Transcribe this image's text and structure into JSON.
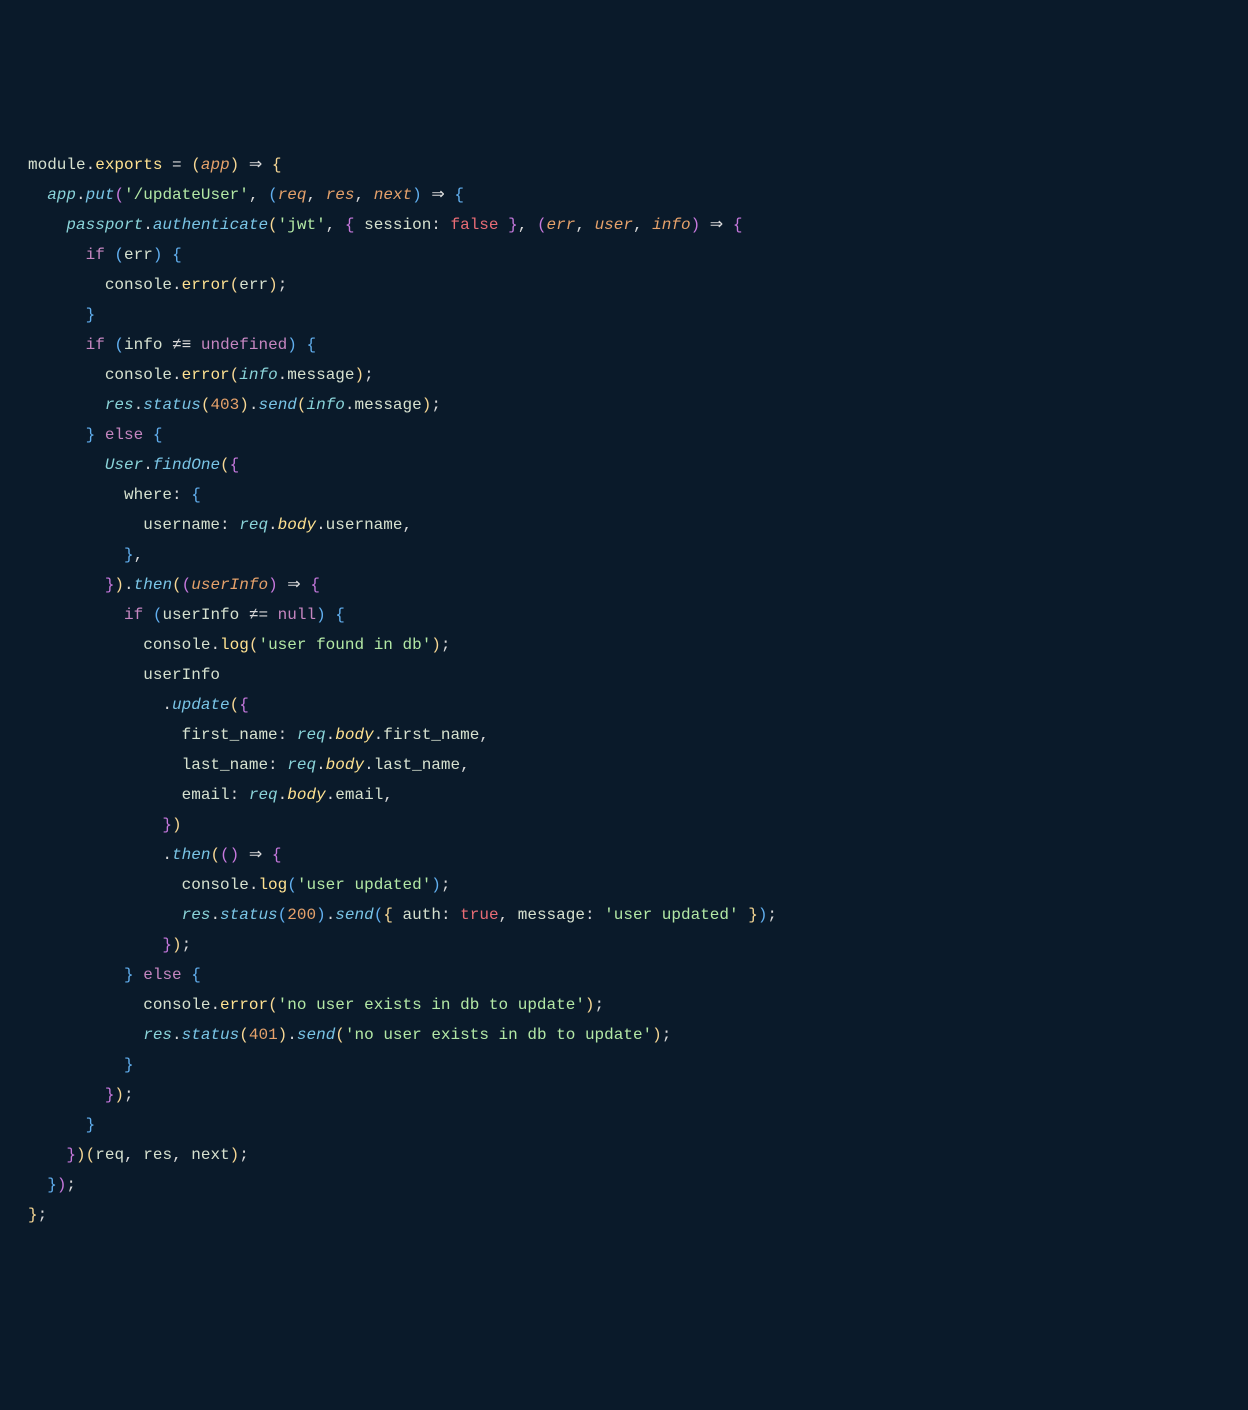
{
  "lines": [
    [
      [
        "t-obj",
        "module"
      ],
      [
        "t-punc",
        "."
      ],
      [
        "t-prop",
        "exports"
      ],
      [
        "t-punc",
        " = "
      ],
      [
        "t-paren",
        "("
      ],
      [
        "t-param",
        "app"
      ],
      [
        "t-paren",
        ")"
      ],
      [
        "t-id",
        " "
      ],
      [
        "t-arrow",
        "⇒"
      ],
      [
        "t-id",
        " "
      ],
      [
        "t-paren",
        "{"
      ]
    ],
    [
      [
        "t-id",
        "  "
      ],
      [
        "t-varital",
        "app"
      ],
      [
        "t-punc",
        "."
      ],
      [
        "t-methital",
        "put"
      ],
      [
        "t-paren2",
        "("
      ],
      [
        "t-str",
        "'/updateUser'"
      ],
      [
        "t-punc",
        ", "
      ],
      [
        "t-paren3",
        "("
      ],
      [
        "t-param",
        "req"
      ],
      [
        "t-punc",
        ", "
      ],
      [
        "t-param",
        "res"
      ],
      [
        "t-punc",
        ", "
      ],
      [
        "t-param",
        "next"
      ],
      [
        "t-paren3",
        ")"
      ],
      [
        "t-id",
        " "
      ],
      [
        "t-arrow",
        "⇒"
      ],
      [
        "t-id",
        " "
      ],
      [
        "t-paren3",
        "{"
      ]
    ],
    [
      [
        "t-id",
        "    "
      ],
      [
        "t-varital",
        "passport"
      ],
      [
        "t-punc",
        "."
      ],
      [
        "t-methital",
        "authenticate"
      ],
      [
        "t-paren",
        "("
      ],
      [
        "t-str",
        "'jwt'"
      ],
      [
        "t-punc",
        ", "
      ],
      [
        "t-paren2",
        "{"
      ],
      [
        "t-id",
        " session"
      ],
      [
        "t-punc",
        ": "
      ],
      [
        "t-bool",
        "false"
      ],
      [
        "t-id",
        " "
      ],
      [
        "t-paren2",
        "}"
      ],
      [
        "t-punc",
        ", "
      ],
      [
        "t-paren2",
        "("
      ],
      [
        "t-param",
        "err"
      ],
      [
        "t-punc",
        ", "
      ],
      [
        "t-param",
        "user"
      ],
      [
        "t-punc",
        ", "
      ],
      [
        "t-param",
        "info"
      ],
      [
        "t-paren2",
        ")"
      ],
      [
        "t-id",
        " "
      ],
      [
        "t-arrow",
        "⇒"
      ],
      [
        "t-id",
        " "
      ],
      [
        "t-paren2",
        "{"
      ]
    ],
    [
      [
        "t-id",
        "      "
      ],
      [
        "t-keyword",
        "if"
      ],
      [
        "t-id",
        " "
      ],
      [
        "t-paren3",
        "("
      ],
      [
        "t-id",
        "err"
      ],
      [
        "t-paren3",
        ")"
      ],
      [
        "t-id",
        " "
      ],
      [
        "t-paren3",
        "{"
      ]
    ],
    [
      [
        "t-id",
        "        "
      ],
      [
        "t-obj",
        "console"
      ],
      [
        "t-punc",
        "."
      ],
      [
        "t-prop",
        "error"
      ],
      [
        "t-paren",
        "("
      ],
      [
        "t-id",
        "err"
      ],
      [
        "t-paren",
        ")"
      ],
      [
        "t-punc",
        ";"
      ]
    ],
    [
      [
        "t-id",
        "      "
      ],
      [
        "t-paren3",
        "}"
      ]
    ],
    [
      [
        "t-id",
        "      "
      ],
      [
        "t-keyword",
        "if"
      ],
      [
        "t-id",
        " "
      ],
      [
        "t-paren3",
        "("
      ],
      [
        "t-id",
        "info "
      ],
      [
        "t-punc",
        "≠≡"
      ],
      [
        "t-id",
        " "
      ],
      [
        "t-lit",
        "undefined"
      ],
      [
        "t-paren3",
        ")"
      ],
      [
        "t-id",
        " "
      ],
      [
        "t-paren3",
        "{"
      ]
    ],
    [
      [
        "t-id",
        "        "
      ],
      [
        "t-obj",
        "console"
      ],
      [
        "t-punc",
        "."
      ],
      [
        "t-prop",
        "error"
      ],
      [
        "t-paren",
        "("
      ],
      [
        "t-varital",
        "info"
      ],
      [
        "t-punc",
        "."
      ],
      [
        "t-id",
        "message"
      ],
      [
        "t-paren",
        ")"
      ],
      [
        "t-punc",
        ";"
      ]
    ],
    [
      [
        "t-id",
        "        "
      ],
      [
        "t-varital",
        "res"
      ],
      [
        "t-punc",
        "."
      ],
      [
        "t-methital",
        "status"
      ],
      [
        "t-paren",
        "("
      ],
      [
        "t-num",
        "403"
      ],
      [
        "t-paren",
        ")"
      ],
      [
        "t-punc",
        "."
      ],
      [
        "t-methital",
        "send"
      ],
      [
        "t-paren",
        "("
      ],
      [
        "t-varital",
        "info"
      ],
      [
        "t-punc",
        "."
      ],
      [
        "t-id",
        "message"
      ],
      [
        "t-paren",
        ")"
      ],
      [
        "t-punc",
        ";"
      ]
    ],
    [
      [
        "t-id",
        "      "
      ],
      [
        "t-paren3",
        "}"
      ],
      [
        "t-id",
        " "
      ],
      [
        "t-keyword",
        "else"
      ],
      [
        "t-id",
        " "
      ],
      [
        "t-paren3",
        "{"
      ]
    ],
    [
      [
        "t-id",
        "        "
      ],
      [
        "t-varital",
        "User"
      ],
      [
        "t-punc",
        "."
      ],
      [
        "t-methital",
        "findOne"
      ],
      [
        "t-paren",
        "("
      ],
      [
        "t-paren2",
        "{"
      ]
    ],
    [
      [
        "t-id",
        "          where"
      ],
      [
        "t-punc",
        ": "
      ],
      [
        "t-paren3",
        "{"
      ]
    ],
    [
      [
        "t-id",
        "            username"
      ],
      [
        "t-punc",
        ": "
      ],
      [
        "t-varital",
        "req"
      ],
      [
        "t-punc",
        "."
      ],
      [
        "t-propital",
        "body"
      ],
      [
        "t-punc",
        "."
      ],
      [
        "t-id",
        "username"
      ],
      [
        "t-punc",
        ","
      ]
    ],
    [
      [
        "t-id",
        "          "
      ],
      [
        "t-paren3",
        "}"
      ],
      [
        "t-punc",
        ","
      ]
    ],
    [
      [
        "t-id",
        "        "
      ],
      [
        "t-paren2",
        "}"
      ],
      [
        "t-paren",
        ")"
      ],
      [
        "t-punc",
        "."
      ],
      [
        "t-methital",
        "then"
      ],
      [
        "t-paren",
        "("
      ],
      [
        "t-paren2",
        "("
      ],
      [
        "t-param",
        "userInfo"
      ],
      [
        "t-paren2",
        ")"
      ],
      [
        "t-id",
        " "
      ],
      [
        "t-arrow",
        "⇒"
      ],
      [
        "t-id",
        " "
      ],
      [
        "t-paren2",
        "{"
      ]
    ],
    [
      [
        "t-id",
        "          "
      ],
      [
        "t-keyword",
        "if"
      ],
      [
        "t-id",
        " "
      ],
      [
        "t-paren3",
        "("
      ],
      [
        "t-id",
        "userInfo "
      ],
      [
        "t-punc",
        "≠="
      ],
      [
        "t-id",
        " "
      ],
      [
        "t-lit",
        "null"
      ],
      [
        "t-paren3",
        ")"
      ],
      [
        "t-id",
        " "
      ],
      [
        "t-paren3",
        "{"
      ]
    ],
    [
      [
        "t-id",
        "            "
      ],
      [
        "t-obj",
        "console"
      ],
      [
        "t-punc",
        "."
      ],
      [
        "t-prop",
        "log"
      ],
      [
        "t-paren",
        "("
      ],
      [
        "t-str",
        "'user found in db'"
      ],
      [
        "t-paren",
        ")"
      ],
      [
        "t-punc",
        ";"
      ]
    ],
    [
      [
        "t-id",
        "            userInfo"
      ]
    ],
    [
      [
        "t-id",
        "              "
      ],
      [
        "t-punc",
        "."
      ],
      [
        "t-methital",
        "update"
      ],
      [
        "t-paren",
        "("
      ],
      [
        "t-paren2",
        "{"
      ]
    ],
    [
      [
        "t-id",
        "                first_name"
      ],
      [
        "t-punc",
        ": "
      ],
      [
        "t-varital",
        "req"
      ],
      [
        "t-punc",
        "."
      ],
      [
        "t-propital",
        "body"
      ],
      [
        "t-punc",
        "."
      ],
      [
        "t-id",
        "first_name"
      ],
      [
        "t-punc",
        ","
      ]
    ],
    [
      [
        "t-id",
        "                last_name"
      ],
      [
        "t-punc",
        ": "
      ],
      [
        "t-varital",
        "req"
      ],
      [
        "t-punc",
        "."
      ],
      [
        "t-propital",
        "body"
      ],
      [
        "t-punc",
        "."
      ],
      [
        "t-id",
        "last_name"
      ],
      [
        "t-punc",
        ","
      ]
    ],
    [
      [
        "t-id",
        "                email"
      ],
      [
        "t-punc",
        ": "
      ],
      [
        "t-varital",
        "req"
      ],
      [
        "t-punc",
        "."
      ],
      [
        "t-propital",
        "body"
      ],
      [
        "t-punc",
        "."
      ],
      [
        "t-id",
        "email"
      ],
      [
        "t-punc",
        ","
      ]
    ],
    [
      [
        "t-id",
        "              "
      ],
      [
        "t-paren2",
        "}"
      ],
      [
        "t-paren",
        ")"
      ]
    ],
    [
      [
        "t-id",
        "              "
      ],
      [
        "t-punc",
        "."
      ],
      [
        "t-methital",
        "then"
      ],
      [
        "t-paren",
        "("
      ],
      [
        "t-paren2",
        "("
      ],
      [
        "t-paren2",
        ")"
      ],
      [
        "t-id",
        " "
      ],
      [
        "t-arrow",
        "⇒"
      ],
      [
        "t-id",
        " "
      ],
      [
        "t-paren2",
        "{"
      ]
    ],
    [
      [
        "t-id",
        "                "
      ],
      [
        "t-obj",
        "console"
      ],
      [
        "t-punc",
        "."
      ],
      [
        "t-prop",
        "log"
      ],
      [
        "t-paren3",
        "("
      ],
      [
        "t-str",
        "'user updated'"
      ],
      [
        "t-paren3",
        ")"
      ],
      [
        "t-punc",
        ";"
      ]
    ],
    [
      [
        "t-id",
        "                "
      ],
      [
        "t-varital",
        "res"
      ],
      [
        "t-punc",
        "."
      ],
      [
        "t-methital",
        "status"
      ],
      [
        "t-paren3",
        "("
      ],
      [
        "t-num",
        "200"
      ],
      [
        "t-paren3",
        ")"
      ],
      [
        "t-punc",
        "."
      ],
      [
        "t-methital",
        "send"
      ],
      [
        "t-paren3",
        "("
      ],
      [
        "t-paren",
        "{"
      ],
      [
        "t-id",
        " auth"
      ],
      [
        "t-punc",
        ": "
      ],
      [
        "t-bool",
        "true"
      ],
      [
        "t-punc",
        ", "
      ],
      [
        "t-id",
        "message"
      ],
      [
        "t-punc",
        ": "
      ],
      [
        "t-str",
        "'user updated'"
      ],
      [
        "t-id",
        " "
      ],
      [
        "t-paren",
        "}"
      ],
      [
        "t-paren3",
        ")"
      ],
      [
        "t-punc",
        ";"
      ]
    ],
    [
      [
        "t-id",
        "              "
      ],
      [
        "t-paren2",
        "}"
      ],
      [
        "t-paren",
        ")"
      ],
      [
        "t-punc",
        ";"
      ]
    ],
    [
      [
        "t-id",
        "          "
      ],
      [
        "t-paren3",
        "}"
      ],
      [
        "t-id",
        " "
      ],
      [
        "t-keyword",
        "else"
      ],
      [
        "t-id",
        " "
      ],
      [
        "t-paren3",
        "{"
      ]
    ],
    [
      [
        "t-id",
        "            "
      ],
      [
        "t-obj",
        "console"
      ],
      [
        "t-punc",
        "."
      ],
      [
        "t-prop",
        "error"
      ],
      [
        "t-paren",
        "("
      ],
      [
        "t-str",
        "'no user exists in db to update'"
      ],
      [
        "t-paren",
        ")"
      ],
      [
        "t-punc",
        ";"
      ]
    ],
    [
      [
        "t-id",
        "            "
      ],
      [
        "t-varital",
        "res"
      ],
      [
        "t-punc",
        "."
      ],
      [
        "t-methital",
        "status"
      ],
      [
        "t-paren",
        "("
      ],
      [
        "t-num",
        "401"
      ],
      [
        "t-paren",
        ")"
      ],
      [
        "t-punc",
        "."
      ],
      [
        "t-methital",
        "send"
      ],
      [
        "t-paren",
        "("
      ],
      [
        "t-str",
        "'no user exists in db to update'"
      ],
      [
        "t-paren",
        ")"
      ],
      [
        "t-punc",
        ";"
      ]
    ],
    [
      [
        "t-id",
        "          "
      ],
      [
        "t-paren3",
        "}"
      ]
    ],
    [
      [
        "t-id",
        "        "
      ],
      [
        "t-paren2",
        "}"
      ],
      [
        "t-paren",
        ")"
      ],
      [
        "t-punc",
        ";"
      ]
    ],
    [
      [
        "t-id",
        "      "
      ],
      [
        "t-paren3",
        "}"
      ]
    ],
    [
      [
        "t-id",
        "    "
      ],
      [
        "t-paren2",
        "}"
      ],
      [
        "t-paren",
        ")"
      ],
      [
        "t-paren",
        "("
      ],
      [
        "t-id",
        "req"
      ],
      [
        "t-punc",
        ", "
      ],
      [
        "t-id",
        "res"
      ],
      [
        "t-punc",
        ", "
      ],
      [
        "t-id",
        "next"
      ],
      [
        "t-paren",
        ")"
      ],
      [
        "t-punc",
        ";"
      ]
    ],
    [
      [
        "t-id",
        "  "
      ],
      [
        "t-paren3",
        "}"
      ],
      [
        "t-paren2",
        ")"
      ],
      [
        "t-punc",
        ";"
      ]
    ],
    [
      [
        "t-paren",
        "}"
      ],
      [
        "t-punc",
        ";"
      ]
    ]
  ]
}
